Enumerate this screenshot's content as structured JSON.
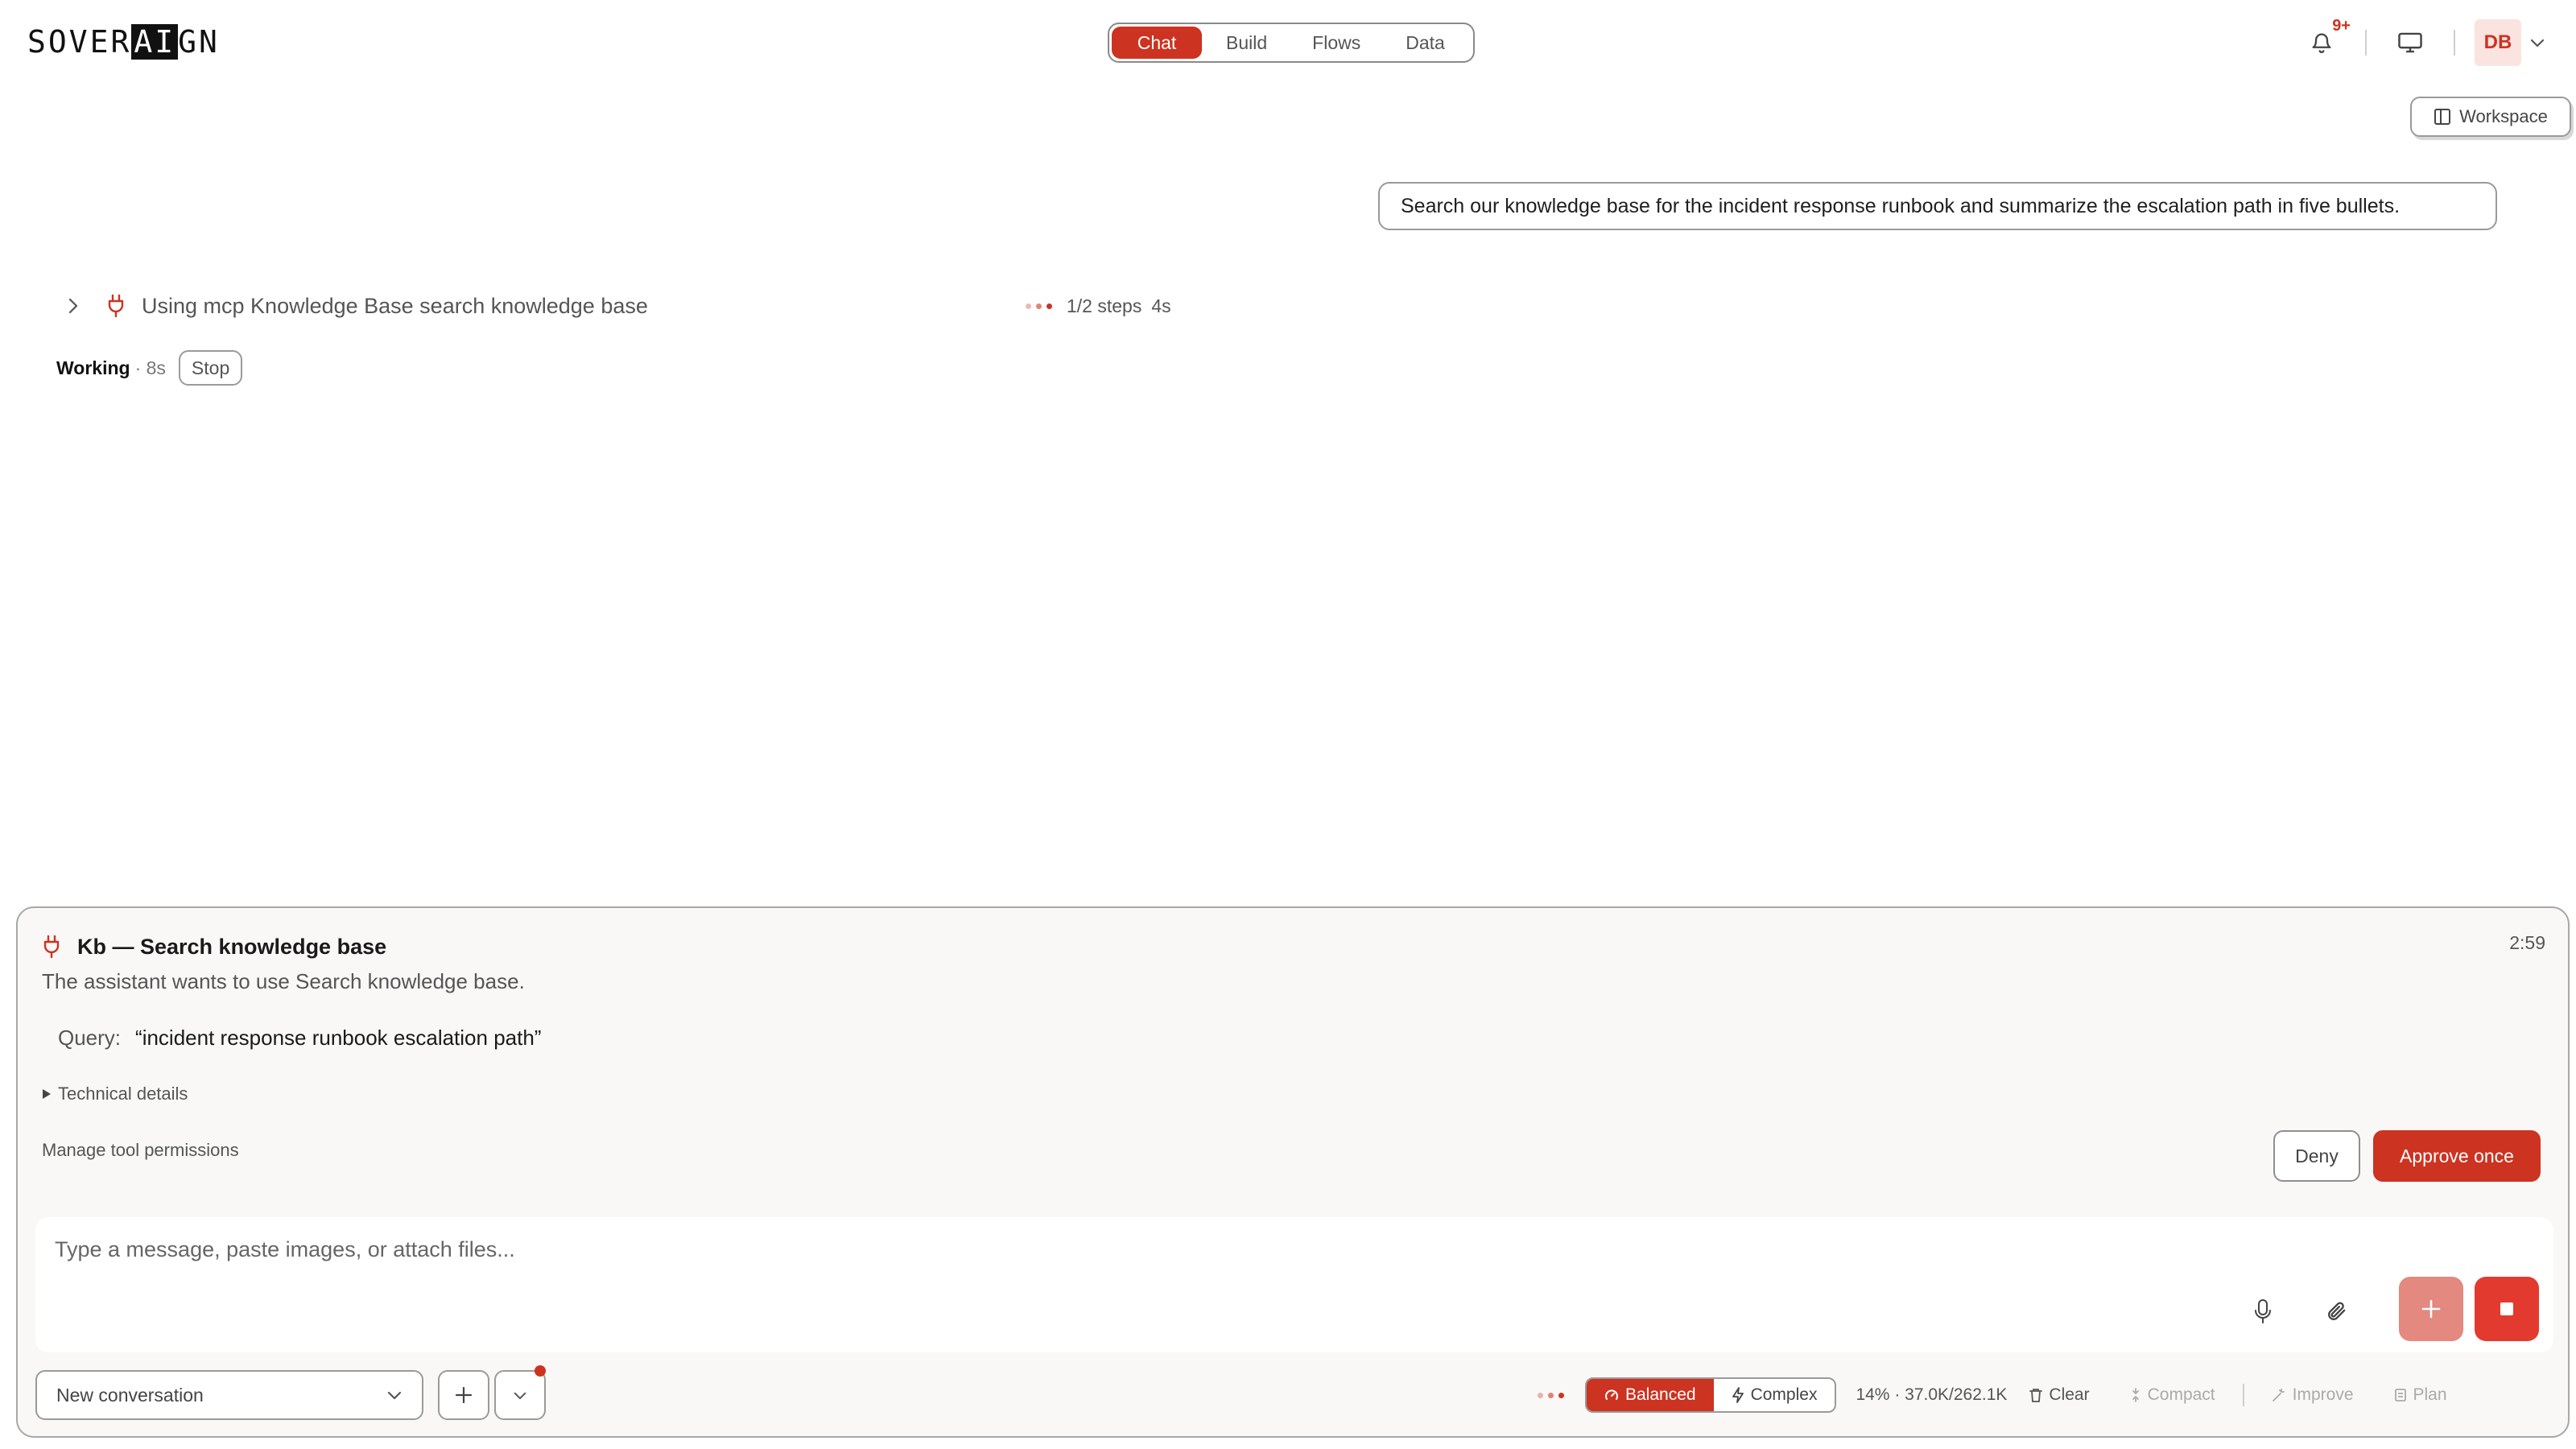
{
  "app": {
    "logo_pre": "SOVER",
    "logo_inv": "AI",
    "logo_post": "GN"
  },
  "nav": {
    "tabs": [
      "Chat",
      "Build",
      "Flows",
      "Data"
    ],
    "active": "Chat"
  },
  "header": {
    "notification_badge": "9+",
    "avatar_initials": "DB",
    "workspace_label": "Workspace"
  },
  "chat": {
    "user_message": "Search our knowledge base for the incident response runbook and summarize the escalation path in five bullets.",
    "tool_call": {
      "label": "Using mcp Knowledge Base search knowledge base",
      "steps": "1/2 steps",
      "elapsed": "4s"
    },
    "status": {
      "label": "Working",
      "time": "· 8s",
      "stop_label": "Stop"
    }
  },
  "permission": {
    "title": "Kb — Search knowledge base",
    "timer": "2:59",
    "description": "The assistant wants to use Search knowledge base.",
    "query_label": "Query:",
    "query_value": "“incident response runbook escalation path”",
    "technical_details": "Technical details",
    "manage_label": "Manage tool permissions",
    "deny_label": "Deny",
    "approve_label": "Approve once"
  },
  "composer": {
    "placeholder": "Type a message, paste images, or attach files...",
    "conversation_select": "New conversation",
    "mode_balanced": "Balanced",
    "mode_complex": "Complex",
    "usage": "14% · 37.0K/262.1K",
    "clear_label": "Clear",
    "compact_label": "Compact",
    "improve_label": "Improve",
    "plan_label": "Plan"
  },
  "colors": {
    "accent": "#cc3321",
    "accent_light": "#e3897f",
    "stop_red": "#e33a30",
    "panel_bg": "#f9f8f6"
  }
}
